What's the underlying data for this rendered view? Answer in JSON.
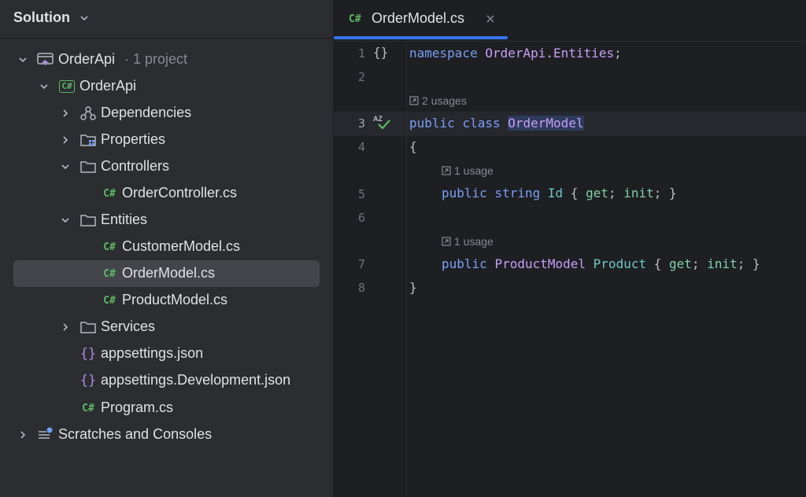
{
  "sidebar": {
    "title": "Solution",
    "root": {
      "label": "OrderApi",
      "suffix": "· 1 project"
    },
    "items": [
      {
        "label": "OrderApi"
      },
      {
        "label": "Dependencies"
      },
      {
        "label": "Properties"
      },
      {
        "label": "Controllers"
      },
      {
        "label": "OrderController.cs"
      },
      {
        "label": "Entities"
      },
      {
        "label": "CustomerModel.cs"
      },
      {
        "label": "OrderModel.cs"
      },
      {
        "label": "ProductModel.cs"
      },
      {
        "label": "Services"
      },
      {
        "label": "appsettings.json"
      },
      {
        "label": "appsettings.Development.json"
      },
      {
        "label": "Program.cs"
      },
      {
        "label": "Scratches and Consoles"
      }
    ],
    "cs_glyph": "C#"
  },
  "editor": {
    "tab": {
      "lang": "C#",
      "title": "OrderModel.cs"
    },
    "line_numbers": [
      "1",
      "2",
      "3",
      "4",
      "5",
      "6",
      "7",
      "8"
    ],
    "hints": {
      "class_usages": "2 usages",
      "id_usages": "1 usage",
      "product_usages": "1 usage"
    },
    "gutter_icons": {
      "braces": "{}",
      "az": "AZ"
    },
    "code": {
      "l1_kw": "namespace",
      "l1_ns": "OrderApi",
      "l1_dot": ".",
      "l1_ns2": "Entities",
      "l1_end": ";",
      "l3_kw1": "public",
      "l3_kw2": "class",
      "l3_name": "OrderModel",
      "l4": "{",
      "l5_kw1": "public",
      "l5_kw2": "string",
      "l5_prop": "Id",
      "l5_open": "{",
      "l5_get": "get",
      "l5_semi1": ";",
      "l5_init": "init",
      "l5_close": "; }",
      "l7_kw1": "public",
      "l7_type": "ProductModel",
      "l7_prop": "Product",
      "l7_open": "{",
      "l7_get": "get",
      "l7_semi1": ";",
      "l7_init": "init",
      "l7_close": "; }",
      "l8": "}"
    }
  },
  "colors": {
    "accent": "#3574f0",
    "csharp": "#5fb865",
    "keyword": "#7a9ef5",
    "type": "#c89ef7",
    "json": "#a98fe0"
  }
}
